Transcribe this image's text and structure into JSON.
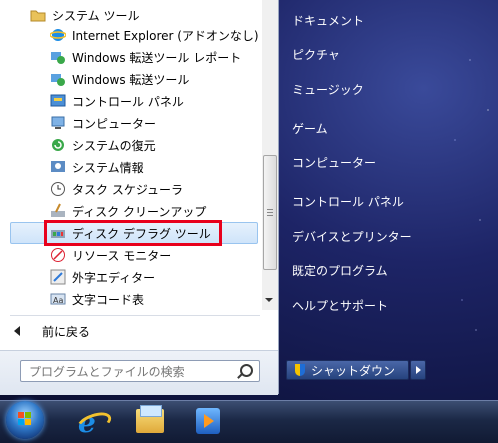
{
  "programs": {
    "folder": "システム ツール",
    "items": [
      {
        "label": "Internet Explorer (アドオンなし)",
        "icon": "ie-icon"
      },
      {
        "label": "Windows 転送ツール レポート",
        "icon": "transfer-icon"
      },
      {
        "label": "Windows 転送ツール",
        "icon": "transfer-icon"
      },
      {
        "label": "コントロール パネル",
        "icon": "control-panel-icon"
      },
      {
        "label": "コンピューター",
        "icon": "computer-icon"
      },
      {
        "label": "システムの復元",
        "icon": "restore-icon"
      },
      {
        "label": "システム情報",
        "icon": "info-icon"
      },
      {
        "label": "タスク スケジューラ",
        "icon": "clock-icon"
      },
      {
        "label": "ディスク クリーンアップ",
        "icon": "disk-cleanup-icon"
      },
      {
        "label": "ディスク デフラグ ツール",
        "icon": "defrag-icon"
      },
      {
        "label": "リソース モニター",
        "icon": "resource-monitor-icon"
      },
      {
        "label": "外字エディター",
        "icon": "char-editor-icon"
      },
      {
        "label": "文字コード表",
        "icon": "char-map-icon"
      }
    ],
    "back_label": "前に戻る"
  },
  "search": {
    "placeholder": "プログラムとファイルの検索"
  },
  "right_menu": {
    "items": [
      "ドキュメント",
      "ピクチャ",
      "ミュージック",
      "ゲーム",
      "コンピューター",
      "コントロール パネル",
      "デバイスとプリンター",
      "既定のプログラム",
      "ヘルプとサポート"
    ],
    "shutdown_label": "シャットダウン"
  },
  "colors": {
    "selection_border": "#e8001c",
    "highlight": "#cfe4fa"
  }
}
